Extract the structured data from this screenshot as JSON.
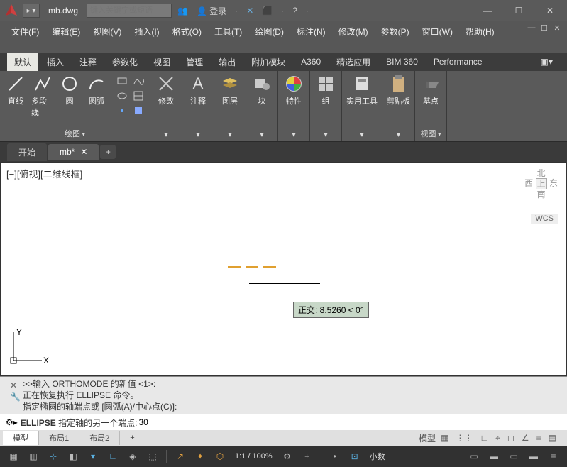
{
  "title": {
    "filename": "mb.dwg",
    "search_placeholder": "键入关键字或短语",
    "login": "登录"
  },
  "menu": {
    "items": [
      "文件(F)",
      "编辑(E)",
      "视图(V)",
      "插入(I)",
      "格式(O)",
      "工具(T)",
      "绘图(D)",
      "标注(N)",
      "修改(M)",
      "参数(P)",
      "窗口(W)",
      "帮助(H)"
    ]
  },
  "ribbon_tabs": [
    "默认",
    "插入",
    "注释",
    "参数化",
    "视图",
    "管理",
    "输出",
    "附加模块",
    "A360",
    "精选应用",
    "BIM 360",
    "Performance"
  ],
  "panels": {
    "draw": {
      "title": "绘图",
      "tools": [
        "直线",
        "多段线",
        "圆",
        "圆弧"
      ]
    },
    "modify": {
      "title": "修改"
    },
    "annot": {
      "title": "注释"
    },
    "layer": {
      "title": "图层"
    },
    "block": {
      "title": "块"
    },
    "prop": {
      "title": "特性"
    },
    "group": {
      "title": "组"
    },
    "util": {
      "title": "实用工具"
    },
    "clip": {
      "title": "剪贴板"
    },
    "base": {
      "title": "基点"
    },
    "view": {
      "title": "视图"
    }
  },
  "doc_tabs": {
    "start": "开始",
    "file": "mb*"
  },
  "viewport": {
    "ctrl": "[−][俯视][二维线框]",
    "compass": {
      "n": "北",
      "w": "西",
      "e": "东",
      "s": "南"
    },
    "wcs": "WCS",
    "tip": "正交: 8.5260 < 0°"
  },
  "command": {
    "hist1": ">>输入 ORTHOMODE 的新值 <1>:",
    "hist2": "正在恢复执行 ELLIPSE 命令。",
    "hist3": "指定椭圆的轴端点或 [圆弧(A)/中心点(C)]:",
    "cmd_name": "ELLIPSE",
    "prompt": "指定轴的另一个端点:",
    "input": "30"
  },
  "layout_tabs": {
    "model": "模型",
    "l1": "布局1",
    "l2": "布局2",
    "right_model": "模型"
  },
  "status": {
    "scale": "1:1 / 100%",
    "decimal": "小数"
  }
}
